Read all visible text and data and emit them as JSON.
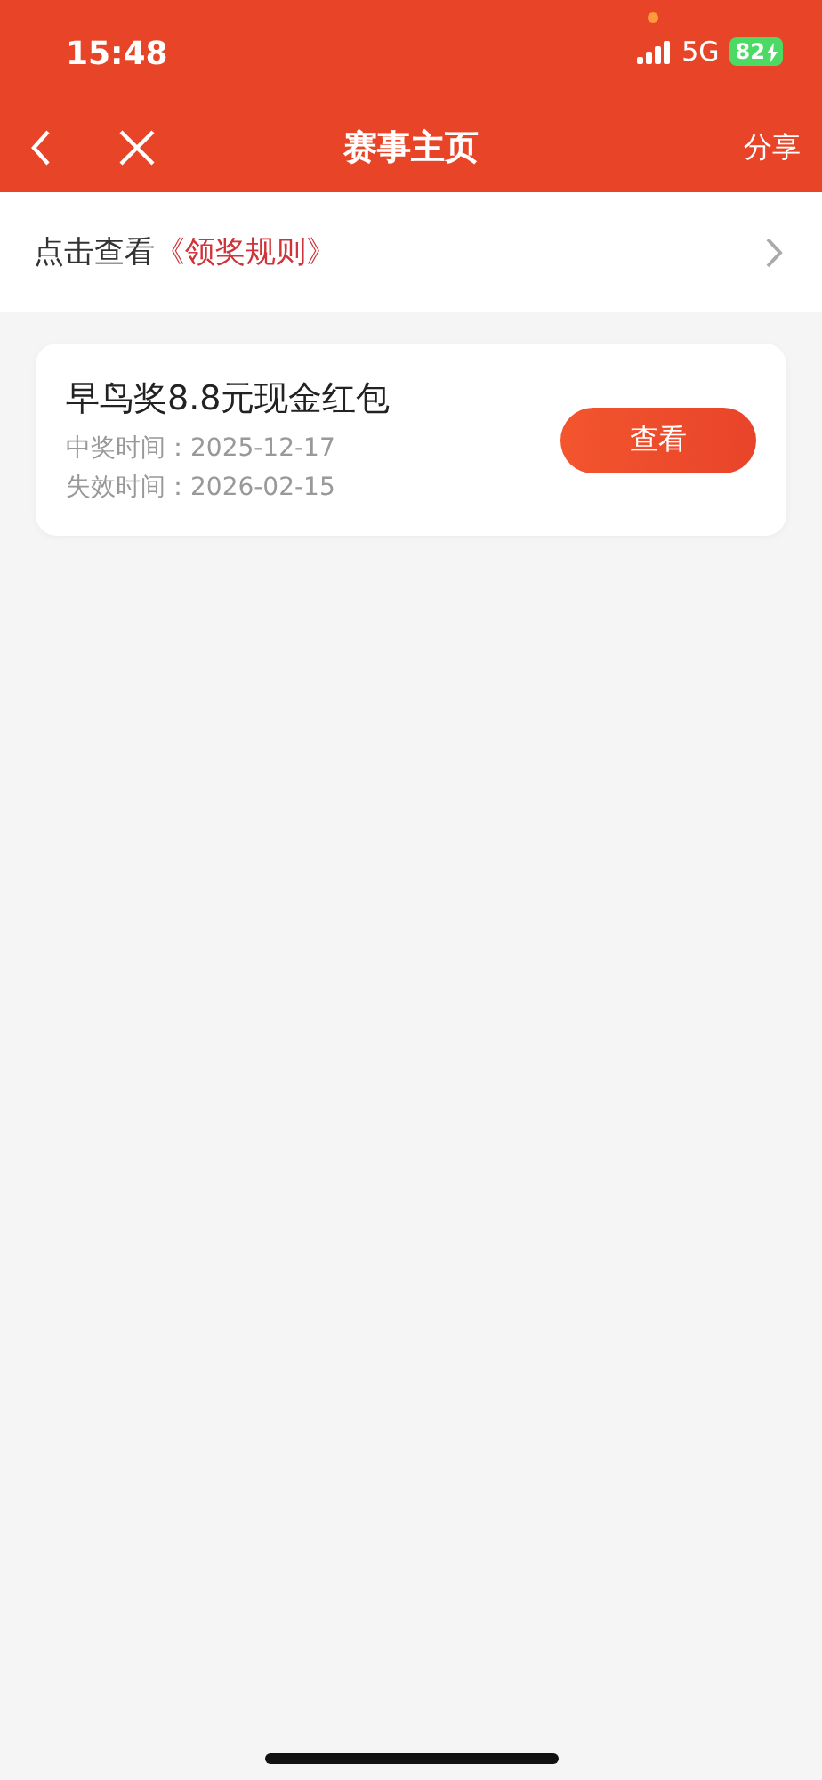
{
  "status_bar": {
    "time": "15:48",
    "network": "5G",
    "battery": "82"
  },
  "nav": {
    "title": "赛事主页",
    "share": "分享"
  },
  "rules": {
    "prefix": "点击查看",
    "link": "《领奖规则》"
  },
  "prizes": [
    {
      "title": "早鸟奖8.8元现金红包",
      "win_time": "中奖时间：2025-12-17",
      "expire_time": "失效时间：2026-02-15",
      "button": "查看"
    }
  ]
}
